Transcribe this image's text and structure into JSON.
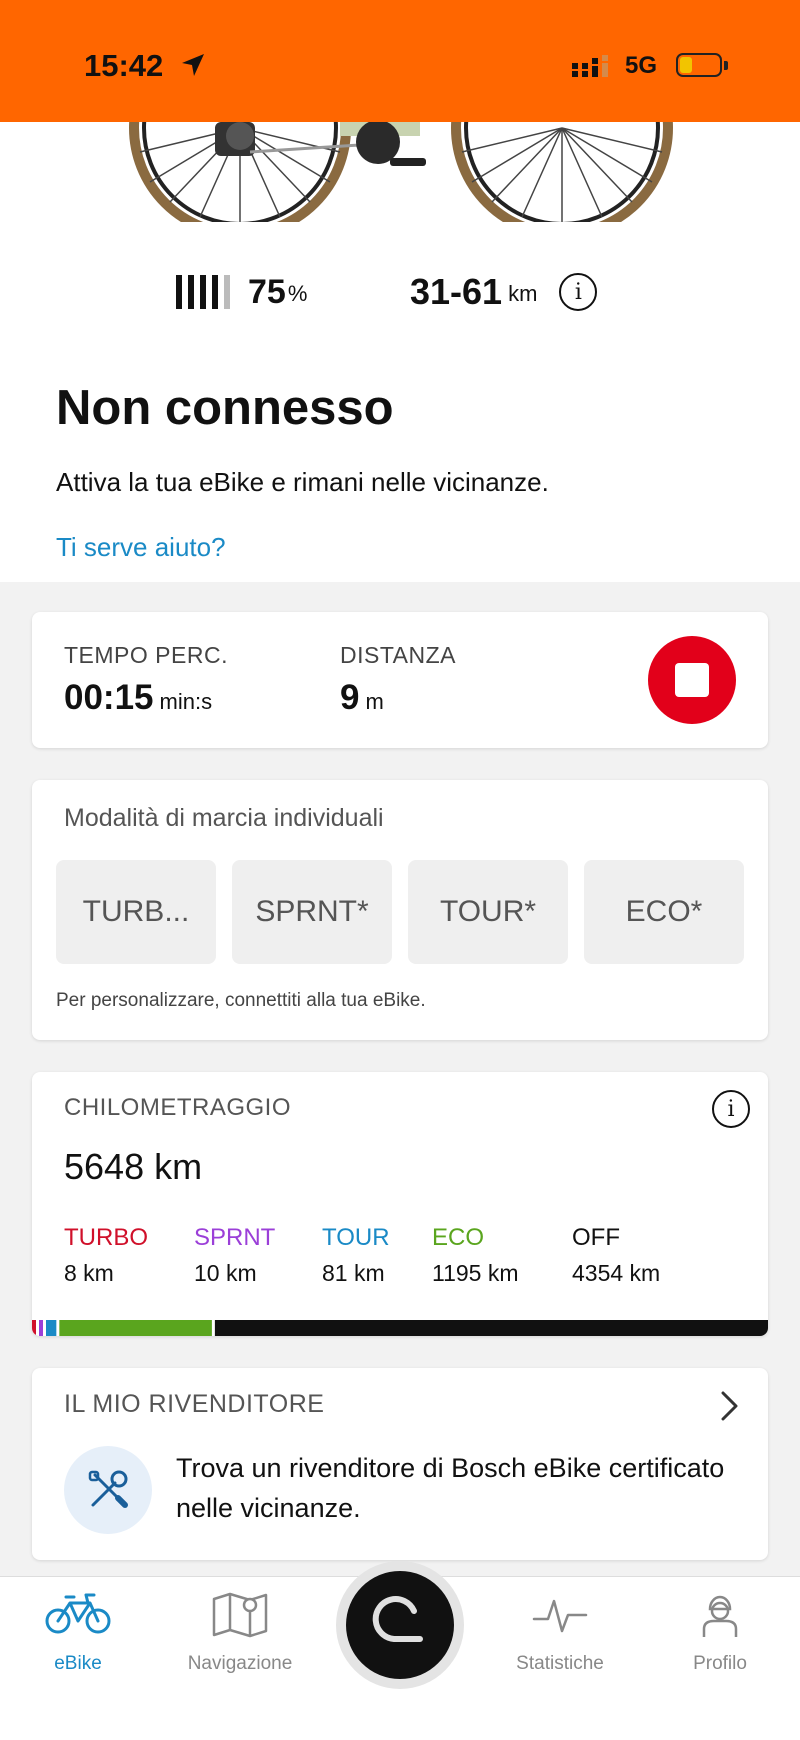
{
  "status_bar": {
    "time": "15:42",
    "network": "5G"
  },
  "bike": {
    "battery_percent": "75",
    "battery_unit": "%",
    "battery_bars_filled": 4,
    "battery_bars_total": 5,
    "range": "31-61",
    "range_unit": "km",
    "info_icon": "i"
  },
  "connection": {
    "title": "Non connesso",
    "subtitle": "Attiva la tua eBike e rimani nelle vicinanze.",
    "help_link": "Ti serve aiuto?"
  },
  "ride": {
    "time_label": "TEMPO PERC.",
    "time_value": "00:15",
    "time_unit": "min:s",
    "distance_label": "DISTANZA",
    "distance_value": "9",
    "distance_unit": "m"
  },
  "modes": {
    "title": "Modalità di marcia individuali",
    "items": [
      "TURB...",
      "SPRNT*",
      "TOUR*",
      "ECO*"
    ],
    "note": "Per personalizzare, connettiti alla tua eBike."
  },
  "odometer": {
    "title": "CHILOMETRAGGIO",
    "total": "5648 km",
    "info_icon": "i",
    "modes": [
      {
        "name": "TURBO",
        "km": "8 km",
        "color": "#d0102a"
      },
      {
        "name": "SPRNT",
        "km": "10 km",
        "color": "#9b3fd8"
      },
      {
        "name": "TOUR",
        "km": "81 km",
        "color": "#1a8ac6"
      },
      {
        "name": "ECO",
        "km": "1195 km",
        "color": "#5aa51e"
      },
      {
        "name": "OFF",
        "km": "4354 km",
        "color": "#111111"
      }
    ]
  },
  "dealer": {
    "title": "IL MIO RIVENDITORE",
    "text": "Trova un rivenditore di Bosch eBike certificato nelle vicinanze."
  },
  "tabs": {
    "ebike": "eBike",
    "navigation": "Navigazione",
    "stats": "Statistiche",
    "profile": "Profilo"
  },
  "colors": {
    "brand_orange": "#ff6600",
    "link_blue": "#1a8ac6",
    "stop_red": "#e2001a"
  }
}
